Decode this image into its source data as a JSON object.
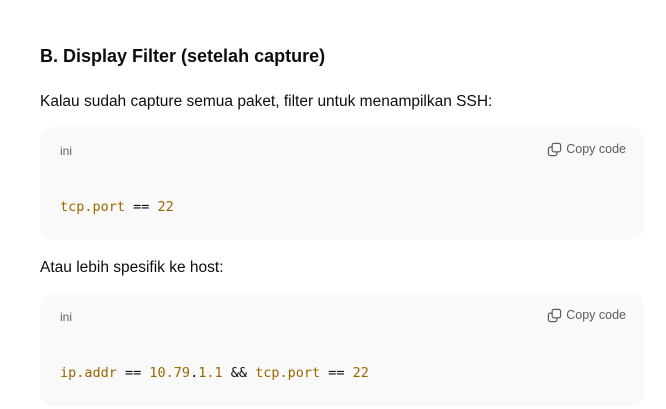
{
  "section": {
    "heading": "B. Display Filter (setelah capture)",
    "intro": "Kalau sudah capture semua paket, filter untuk menampilkan SSH:",
    "followup": "Atau lebih spesifik ke host:"
  },
  "code_blocks": [
    {
      "language": "ini",
      "copy_label": "Copy code",
      "tokens": {
        "field": "tcp.port",
        "op": " == ",
        "value": "22"
      }
    },
    {
      "language": "ini",
      "copy_label": "Copy code",
      "tokens": {
        "field1": "ip.addr",
        "op1": " == ",
        "num_a": "10.79",
        "dot_a": ".",
        "num_b": "1.1",
        "and": " && ",
        "field2": "tcp.port",
        "op2": " == ",
        "value2": "22"
      }
    }
  ],
  "colors": {
    "code_background": "#f9f9f9",
    "token_color": "#986801",
    "muted_text": "#5d5d5d"
  },
  "icons": {
    "copy": "copy-icon"
  }
}
